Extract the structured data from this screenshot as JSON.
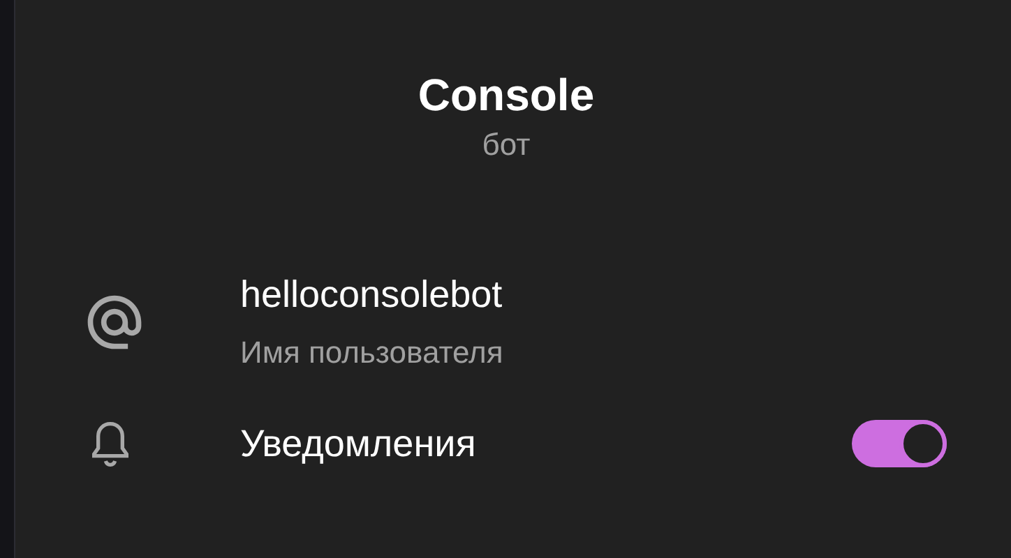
{
  "header": {
    "title": "Console",
    "subtitle": "бот"
  },
  "rows": [
    {
      "kind": "username",
      "value": "helloconsolebot",
      "label": "Имя пользователя"
    },
    {
      "kind": "toggle",
      "label": "Уведомления",
      "on": true
    }
  ]
}
